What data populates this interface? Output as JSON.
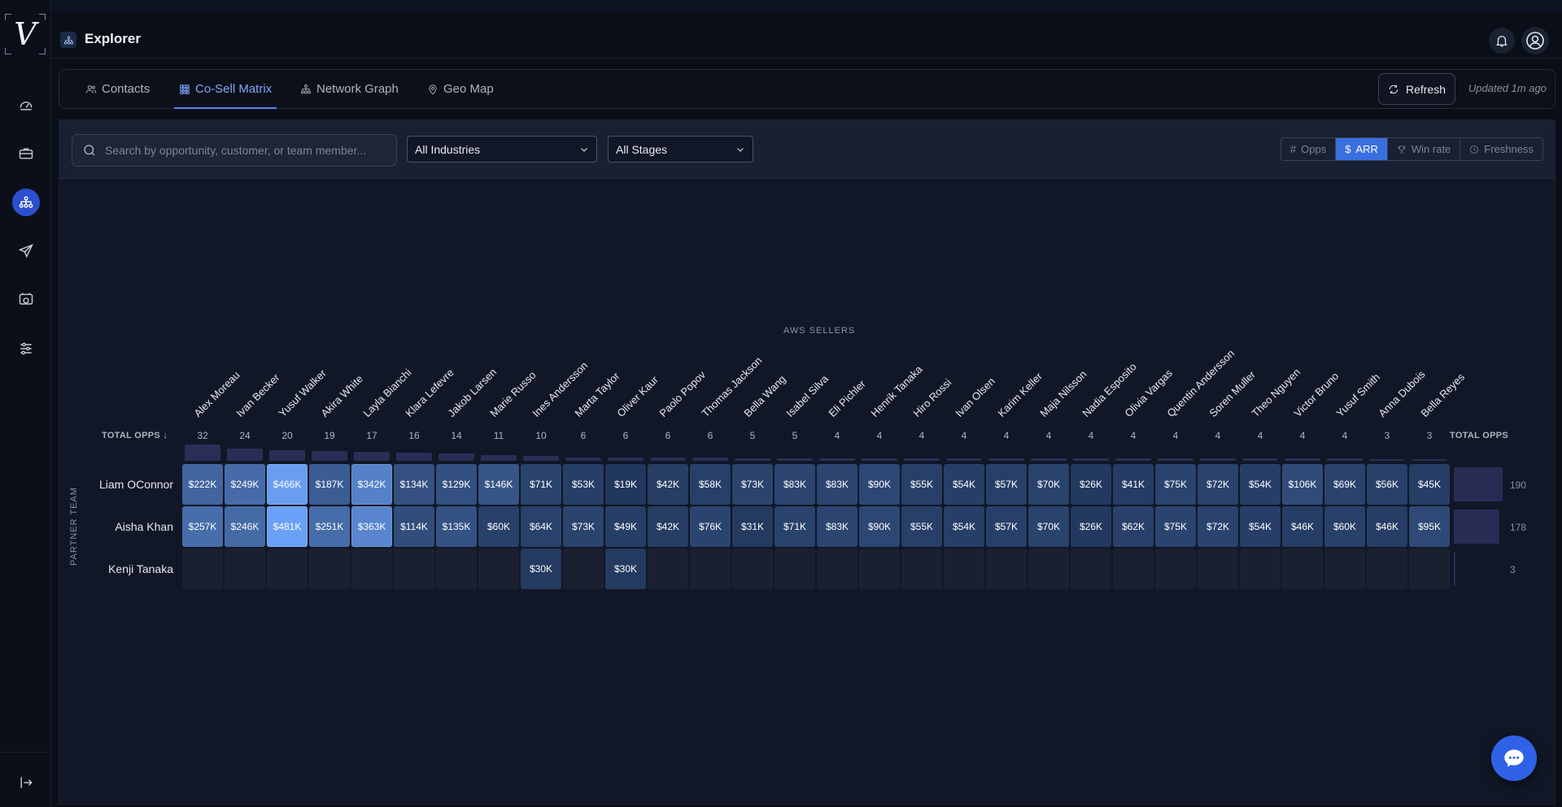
{
  "app": {
    "title": "Explorer",
    "logo_letter": "V"
  },
  "tabs": [
    {
      "label": "Contacts",
      "icon": "users-icon"
    },
    {
      "label": "Co-Sell Matrix",
      "icon": "grid-icon",
      "active": true
    },
    {
      "label": "Network Graph",
      "icon": "network-icon"
    },
    {
      "label": "Geo Map",
      "icon": "map-pin-icon"
    }
  ],
  "toolbar": {
    "refresh_label": "Refresh",
    "updated": "Updated 1m ago"
  },
  "filters": {
    "search_placeholder": "Search by opportunity, customer, or team member...",
    "industry": "All Industries",
    "stage": "All Stages"
  },
  "metric_toggle": [
    {
      "symbol": "#",
      "label": "Opps"
    },
    {
      "symbol": "$",
      "label": "ARR",
      "active": true
    },
    {
      "symbol": "trophy",
      "label": "Win rate"
    },
    {
      "symbol": "clock",
      "label": "Freshness"
    }
  ],
  "matrix": {
    "column_axis_title": "AWS SELLERS",
    "row_axis_title": "PARTNER TEAM",
    "total_label_left": "TOTAL OPPS ↓",
    "total_label_right": "TOTAL OPPS",
    "columns": [
      {
        "name": "Alex Moreau",
        "total": 32
      },
      {
        "name": "Ivan Becker",
        "total": 24
      },
      {
        "name": "Yusuf Walker",
        "total": 20
      },
      {
        "name": "Akira White",
        "total": 19
      },
      {
        "name": "Layla Bianchi",
        "total": 17
      },
      {
        "name": "Klara Lefevre",
        "total": 16
      },
      {
        "name": "Jakob Larsen",
        "total": 14
      },
      {
        "name": "Marie Russo",
        "total": 11
      },
      {
        "name": "Ines Andersson",
        "total": 10
      },
      {
        "name": "Marta Taylor",
        "total": 6
      },
      {
        "name": "Oliver Kaur",
        "total": 6
      },
      {
        "name": "Paolo Popov",
        "total": 6
      },
      {
        "name": "Thomas Jackson",
        "total": 6
      },
      {
        "name": "Bella Wang",
        "total": 5
      },
      {
        "name": "Isabel Silva",
        "total": 5
      },
      {
        "name": "Eli Pichler",
        "total": 4
      },
      {
        "name": "Henrik Tanaka",
        "total": 4
      },
      {
        "name": "Hiro Rossi",
        "total": 4
      },
      {
        "name": "Ivan Olsen",
        "total": 4
      },
      {
        "name": "Karim Keller",
        "total": 4
      },
      {
        "name": "Maja Nilsson",
        "total": 4
      },
      {
        "name": "Nadia Esposito",
        "total": 4
      },
      {
        "name": "Olivia Vargas",
        "total": 4
      },
      {
        "name": "Quentin Andersson",
        "total": 4
      },
      {
        "name": "Soren Muller",
        "total": 4
      },
      {
        "name": "Theo Nguyen",
        "total": 4
      },
      {
        "name": "Victor Bruno",
        "total": 4
      },
      {
        "name": "Yusuf Smith",
        "total": 4
      },
      {
        "name": "Anna Dubois",
        "total": 3
      },
      {
        "name": "Bella Reyes",
        "total": 3
      }
    ],
    "rows": [
      {
        "name": "Liam OConnor",
        "total": 190,
        "values": [
          222,
          249,
          466,
          187,
          342,
          134,
          129,
          146,
          71,
          53,
          19,
          42,
          58,
          73,
          83,
          83,
          90,
          55,
          54,
          57,
          70,
          26,
          41,
          75,
          72,
          54,
          106,
          69,
          56,
          45
        ]
      },
      {
        "name": "Aisha Khan",
        "total": 178,
        "values": [
          257,
          246,
          481,
          251,
          363,
          114,
          135,
          60,
          64,
          73,
          49,
          42,
          76,
          31,
          71,
          83,
          90,
          55,
          54,
          57,
          70,
          26,
          62,
          75,
          72,
          54,
          46,
          60,
          46,
          95
        ]
      },
      {
        "name": "Kenji Tanaka",
        "total": 3,
        "values": [
          null,
          null,
          null,
          null,
          null,
          null,
          null,
          null,
          30,
          null,
          30,
          null,
          null,
          null,
          null,
          null,
          null,
          null,
          null,
          null,
          null,
          null,
          null,
          null,
          null,
          null,
          null,
          null,
          null,
          null
        ]
      }
    ]
  },
  "colors": {
    "accent": "#3a6fe0",
    "cell_empty": "#1a2030",
    "cell_low": "#1f3356",
    "cell_high": "#6aa0f5"
  }
}
